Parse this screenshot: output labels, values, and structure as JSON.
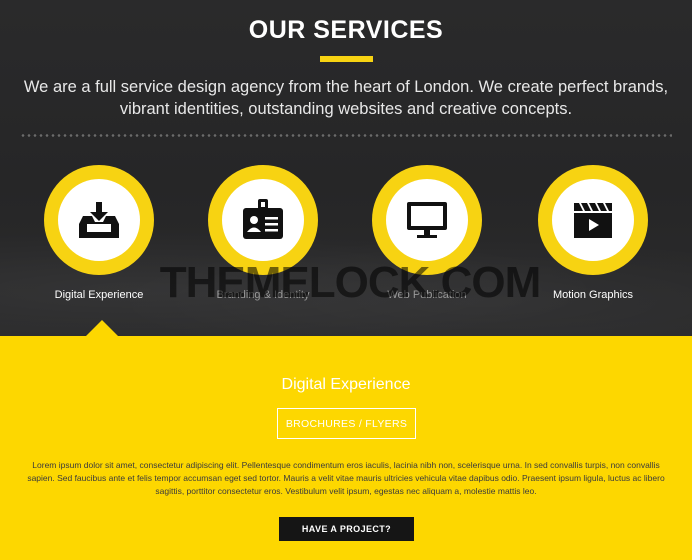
{
  "header": {
    "title": "OUR SERVICES",
    "intro": "We are a full service design agency from the heart of London. We create perfect brands, vibrant identities, outstanding websites and creative concepts."
  },
  "services": [
    {
      "label": "Digital Experience",
      "icon": "inbox-download-icon",
      "active": true
    },
    {
      "label": "Branding & Identity",
      "icon": "id-badge-icon",
      "active": false
    },
    {
      "label": "Web Publication",
      "icon": "monitor-icon",
      "active": false
    },
    {
      "label": "Motion Graphics",
      "icon": "clapperboard-icon",
      "active": false
    }
  ],
  "watermark": "THEMELOCK.COM",
  "detail": {
    "title": "Digital Experience",
    "tag": "BROCHURES / FLYERS",
    "text": "Lorem ipsum dolor sit amet, consectetur adipiscing elit. Pellentesque condimentum eros iaculis, lacinia nibh non, scelerisque urna. In sed convallis turpis, non convallis sapien. Sed faucibus ante et felis tempor accumsan eget sed tortor. Mauris a velit vitae mauris ultricies vehicula vitae dapibus odio. Praesent ipsum ligula, luctus ac libero sagittis, porttitor consectetur eros. Vestibulum velit ipsum, egestas nec aliquam a, molestie mattis leo.",
    "button": "HAVE A PROJECT?"
  },
  "colors": {
    "accent": "#fdd700",
    "dark": "#232323",
    "button": "#151515"
  }
}
